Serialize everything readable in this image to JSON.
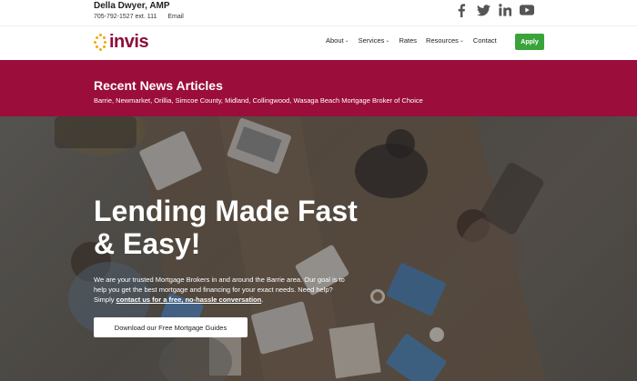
{
  "agent": {
    "name": "Della Dwyer, AMP",
    "phone": "705-792-1527 ext. 111",
    "email_label": "Email"
  },
  "social": [
    "facebook-icon",
    "twitter-icon",
    "linkedin-icon",
    "youtube-icon"
  ],
  "logo": {
    "text": "invis"
  },
  "nav": {
    "items": [
      {
        "label": "About",
        "caret": true
      },
      {
        "label": "Services",
        "caret": true
      },
      {
        "label": "Rates",
        "caret": false
      },
      {
        "label": "Resources",
        "caret": true
      },
      {
        "label": "Contact",
        "caret": false
      }
    ],
    "apply_label": "Apply"
  },
  "banner": {
    "title": "Recent News Articles",
    "subtitle": "Barrie, Newmarket, Orillia, Simcoe County, Midland, Collingwood, Wasaga Beach Mortgage Broker of Choice"
  },
  "hero": {
    "title": "Lending Made Fast & Easy!",
    "body_text": "We are your trusted Mortgage Brokers in and around the Barrie area. Our goal is to help you get the best mortgage and financing for your exact needs. Need help? Simply ",
    "body_link": "contact us for a free, no-hassle conversation",
    "body_end": ".",
    "button_label": "Download our Free Mortgage Guides"
  },
  "colors": {
    "brand": "#9b0d3b",
    "logo_dots": "#f2a900",
    "apply": "#3aa33a"
  }
}
